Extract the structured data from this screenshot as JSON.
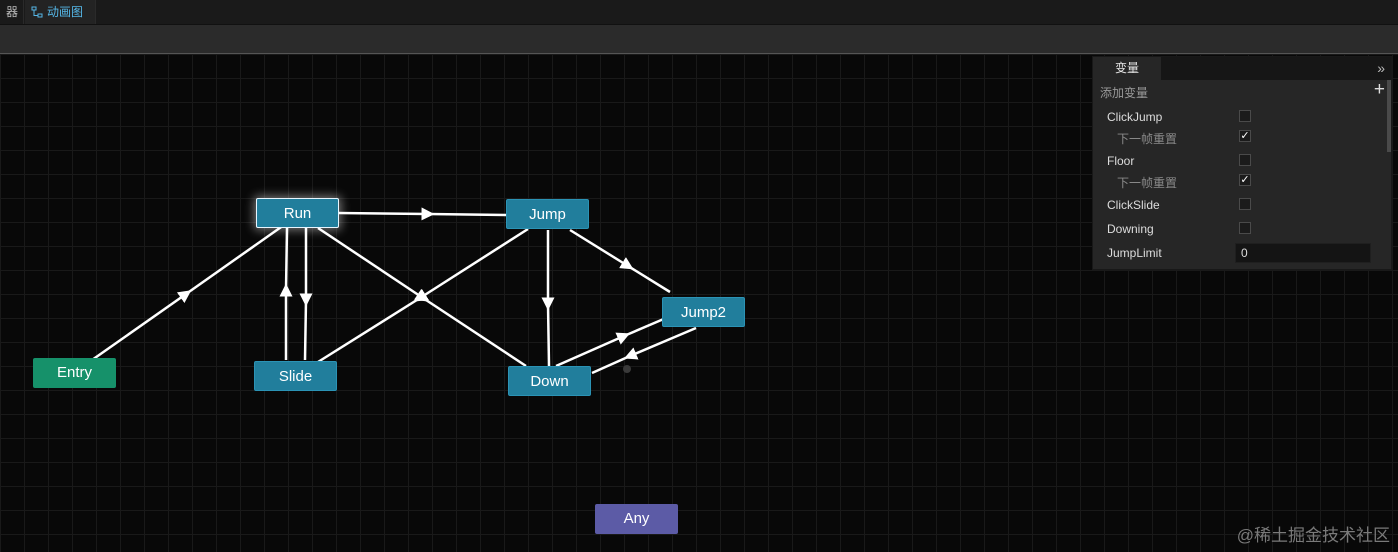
{
  "tabs": {
    "previous_tab_label": "器",
    "animator_tab_label": "动画图"
  },
  "graph": {
    "nodes": {
      "run": "Run",
      "jump": "Jump",
      "jump2": "Jump2",
      "entry": "Entry",
      "slide": "Slide",
      "down": "Down",
      "any": "Any"
    },
    "colors": {
      "state": "#217e9c",
      "entry": "#16916a",
      "any": "#5c5ba6",
      "edge": "#ffffff"
    }
  },
  "variables": {
    "tab_label": "变量",
    "add_label": "添加变量",
    "collapse_icon": "»",
    "add_icon": "+",
    "items": [
      {
        "name": "ClickJump",
        "checked": false
      },
      {
        "name": "下一帧重置",
        "checked": true
      },
      {
        "name": "Floor",
        "checked": false
      },
      {
        "name": "下一帧重置",
        "checked": true
      },
      {
        "name": "ClickSlide",
        "checked": false
      },
      {
        "name": "Downing",
        "checked": false
      },
      {
        "name": "JumpLimit",
        "value": "0"
      }
    ]
  },
  "watermark": "@稀土掘金技术社区"
}
